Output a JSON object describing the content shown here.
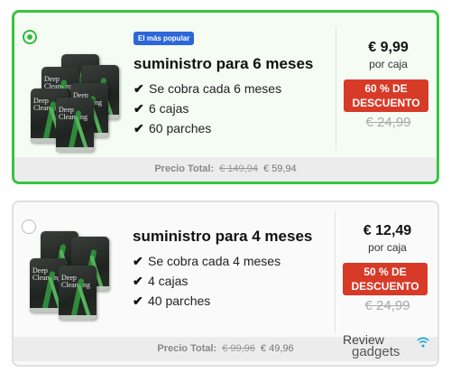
{
  "offer1": {
    "badge": "El más popular",
    "title": "suministro para 6 meses",
    "features": [
      "Se cobra cada 6 meses",
      "6 cajas",
      "60 parches"
    ],
    "price": "€ 9,99",
    "per": "por caja",
    "discount_line1": "60 % DE",
    "discount_line2": "DESCUENTO",
    "old_price": "€ 24,99",
    "total_label": "Precio Total:",
    "total_old": "€ 149,94",
    "total_new": "€ 59,94",
    "selected": true
  },
  "offer2": {
    "title": "suministro para 4 meses",
    "features": [
      "Se cobra cada 4 meses",
      "4 cajas",
      "40 parches"
    ],
    "price": "€ 12,49",
    "per": "por caja",
    "discount_line1": "50 % DE",
    "discount_line2": "DESCUENTO",
    "old_price": "€ 24,99",
    "total_label": "Precio Total:",
    "total_old": "€ 99,96",
    "total_new": "€ 49,96",
    "selected": false
  },
  "product_label": "Deep Cleansing",
  "watermark": {
    "line1": "Review",
    "line2": "gadgets"
  },
  "colors": {
    "selected_border": "#38c441",
    "badge": "#2b67d8",
    "discount": "#d83a28"
  }
}
